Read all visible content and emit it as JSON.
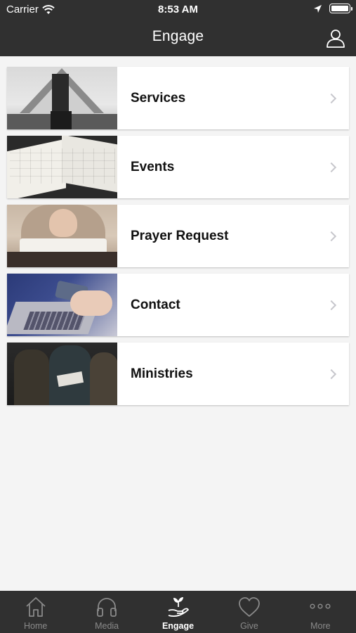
{
  "status_bar": {
    "carrier": "Carrier",
    "time": "8:53 AM",
    "icons": [
      "wifi-icon",
      "location-arrow-icon",
      "battery-icon"
    ]
  },
  "nav": {
    "title": "Engage",
    "right_icon": "profile-icon"
  },
  "menu_items": [
    {
      "label": "Services",
      "thumbnail": "church-building"
    },
    {
      "label": "Events",
      "thumbnail": "open-planner"
    },
    {
      "label": "Prayer Request",
      "thumbnail": "praying-hands"
    },
    {
      "label": "Contact",
      "thumbnail": "phone-and-laptop"
    },
    {
      "label": "Ministries",
      "thumbnail": "group-meeting"
    }
  ],
  "tabs": [
    {
      "label": "Home",
      "icon": "home-icon",
      "active": false
    },
    {
      "label": "Media",
      "icon": "headphones-icon",
      "active": false
    },
    {
      "label": "Engage",
      "icon": "hand-plant-icon",
      "active": true
    },
    {
      "label": "Give",
      "icon": "heart-icon",
      "active": false
    },
    {
      "label": "More",
      "icon": "more-dots-icon",
      "active": false
    }
  ],
  "colors": {
    "bar_background": "#303030",
    "page_background": "#f4f4f4",
    "active_tab": "#ffffff",
    "inactive_tab": "#8a8a8a",
    "chevron": "#c7c7cc"
  }
}
